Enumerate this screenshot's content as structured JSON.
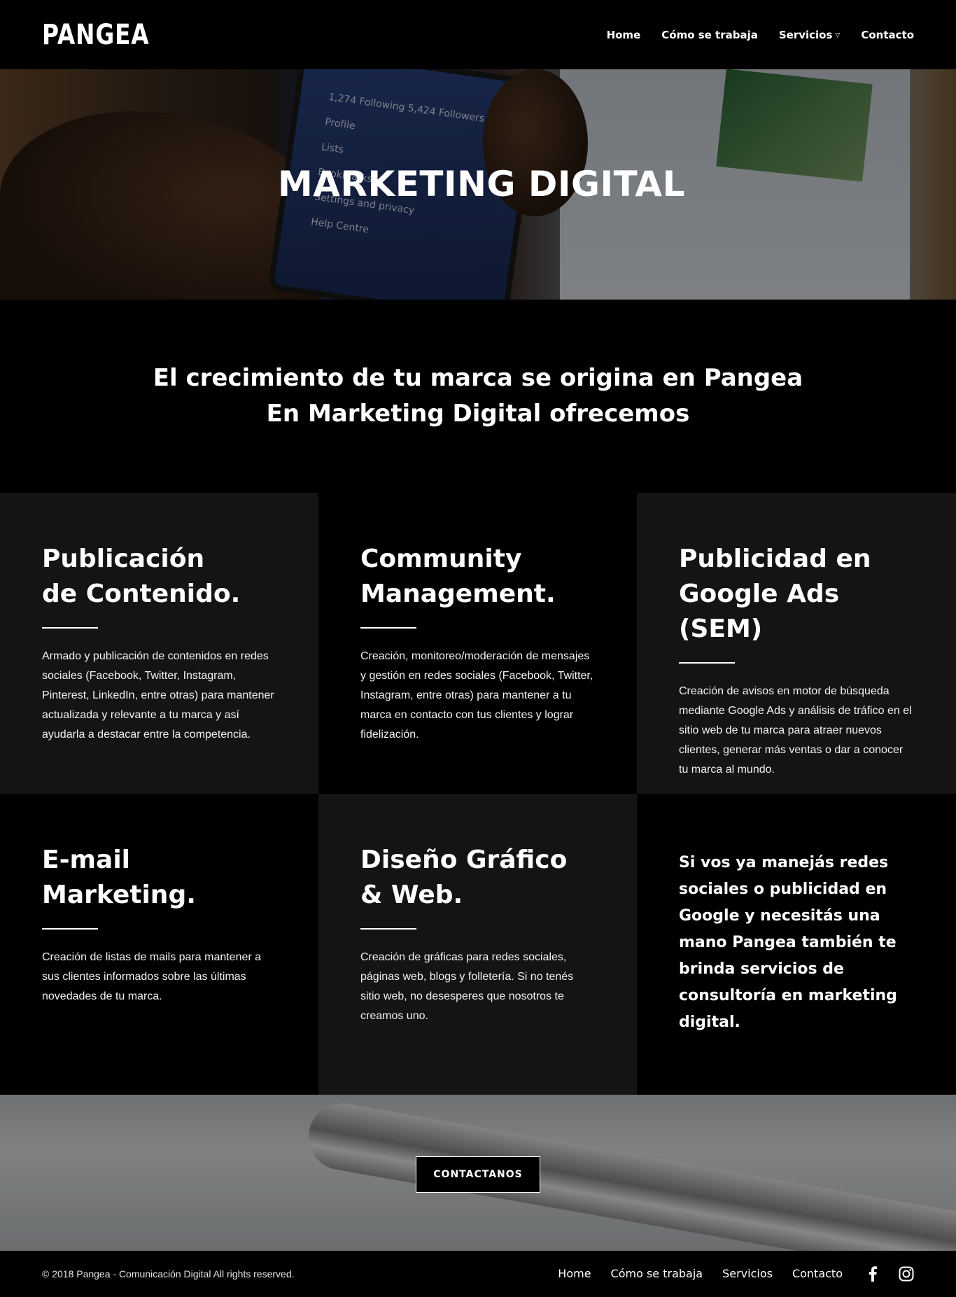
{
  "header": {
    "logo": "PANGEA",
    "nav": [
      {
        "label": "Home"
      },
      {
        "label": "Cómo se trabaja"
      },
      {
        "label": "Servicios"
      },
      {
        "label": "Contacto"
      }
    ]
  },
  "hero": {
    "title": "MARKETING DIGITAL",
    "phone_menu": [
      "1,274 Following  5,424 Followers",
      "Profile",
      "Lists",
      "Bookmarks",
      "Settings and privacy",
      "Help Centre"
    ]
  },
  "intro": {
    "line1": "El crecimiento de tu marca se origina en Pangea",
    "line2": "En Marketing Digital ofrecemos"
  },
  "services": [
    {
      "title_l1": "Publicación",
      "title_l2": "de Contenido.",
      "desc": "Armado y publicación de contenidos en redes sociales (Facebook, Twitter, Instagram, Pinterest, LinkedIn, entre otras) para mantener actualizada y relevante a tu marca y así ayudarla a destacar entre la competencia."
    },
    {
      "title_l1": "Community",
      "title_l2": "Management.",
      "desc": "Creación, monitoreo/moderación de mensajes y gestión en redes sociales (Facebook, Twitter, Instagram, entre otras) para mantener a tu marca en contacto con tus clientes y lograr fidelización."
    },
    {
      "title_l1": "Publicidad en",
      "title_l2": "Google Ads (SEM)",
      "desc": "Creación de avisos en motor de búsqueda mediante Google Ads y análisis de tráfico en el sitio web de tu marca para atraer nuevos clientes, generar más ventas o dar a conocer tu marca al mundo."
    },
    {
      "title_l1": "E-mail",
      "title_l2": "Marketing.",
      "desc": "Creación de listas de mails para mantener a sus clientes informados sobre las últimas novedades de tu marca."
    },
    {
      "title_l1": "Diseño Gráfico",
      "title_l2": "& Web.",
      "desc": "Creación de gráficas para redes sociales, páginas web, blogs y folletería. Si no tenés sitio web, no desesperes que nosotros te creamos uno."
    }
  ],
  "consulting": "Si vos ya manejás redes sociales o publicidad en Google y necesitás una mano Pangea también te brinda servicios de consultoría en marketing digital.",
  "cta": {
    "label": "CONTACTANOS"
  },
  "footer": {
    "copyright": "© 2018 Pangea - Comunicación Digital All rights reserved.",
    "nav": [
      {
        "label": "Home"
      },
      {
        "label": "Cómo se trabaja"
      },
      {
        "label": "Servicios"
      },
      {
        "label": "Contacto"
      }
    ],
    "social": [
      "facebook-icon",
      "instagram-icon"
    ]
  }
}
